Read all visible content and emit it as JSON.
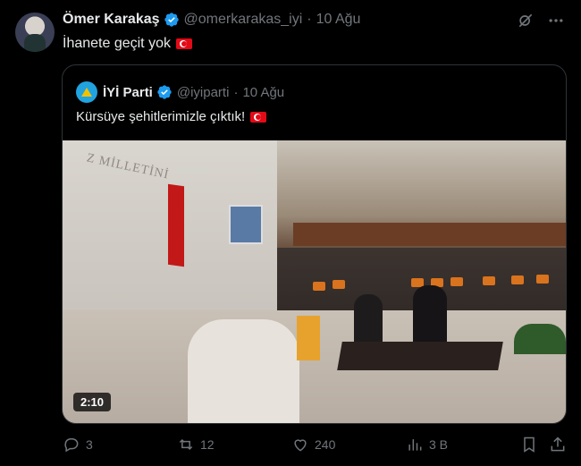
{
  "tweet": {
    "author_name": "Ömer Karakaş",
    "handle": "@omerkarakas_iyi",
    "separator": "·",
    "date": "10 Ağu",
    "text": "İhanete geçit yok",
    "flag_icon": "turkey-flag-icon"
  },
  "quoted_tweet": {
    "author_name": "İYİ Parti",
    "handle": "@iyiparti",
    "separator": "·",
    "date": "10 Ağu",
    "text": "Kürsüye şehitlerimizle çıktık!",
    "flag_icon": "turkey-flag-icon",
    "video": {
      "duration": "2:10",
      "wall_text": "Z MİLLETİNİ"
    }
  },
  "actions": {
    "replies": "3",
    "retweets": "12",
    "likes": "240",
    "views": "3 B"
  },
  "colors": {
    "background": "#000000",
    "text": "#e7e9ea",
    "muted": "#71767b",
    "verified": "#1d9bf0",
    "border": "#2f3336"
  }
}
